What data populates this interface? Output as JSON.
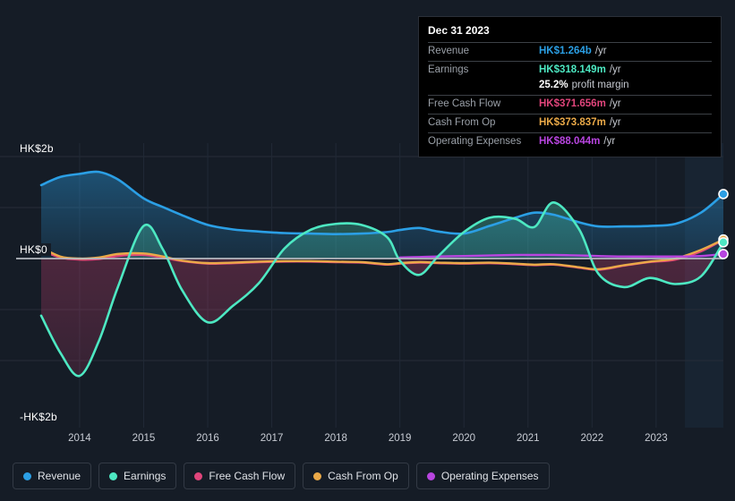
{
  "colors": {
    "background": "#151c26",
    "revenue": "#2b9fe5",
    "earnings": "#4de8c2",
    "free_cash_flow": "#e0457b",
    "cash_from_op": "#eaa948",
    "operating_expenses": "#b845e0",
    "zero_line": "#b9bdc4",
    "grid": "#262d38"
  },
  "tooltip": {
    "date": "Dec 31 2023",
    "rows": [
      {
        "key": "Revenue",
        "value": "HK$1.264b",
        "unit": "/yr",
        "color": "#2b9fe5"
      },
      {
        "key": "Earnings",
        "value": "HK$318.149m",
        "unit": "/yr",
        "color": "#4de8c2"
      },
      {
        "key": "",
        "value": "25.2%",
        "unit": "profit margin",
        "color": "#ffffff"
      },
      {
        "key": "Free Cash Flow",
        "value": "HK$371.656m",
        "unit": "/yr",
        "color": "#e0457b"
      },
      {
        "key": "Cash From Op",
        "value": "HK$373.837m",
        "unit": "/yr",
        "color": "#eaa948"
      },
      {
        "key": "Operating Expenses",
        "value": "HK$88.044m",
        "unit": "/yr",
        "color": "#b845e0"
      }
    ]
  },
  "legend": {
    "items": [
      {
        "label": "Revenue",
        "color": "#2b9fe5"
      },
      {
        "label": "Earnings",
        "color": "#4de8c2"
      },
      {
        "label": "Free Cash Flow",
        "color": "#e0457b"
      },
      {
        "label": "Cash From Op",
        "color": "#eaa948"
      },
      {
        "label": "Operating Expenses",
        "color": "#b845e0"
      }
    ]
  },
  "axis": {
    "y_top_label": "HK$2b",
    "y_zero_label": "HK$0",
    "y_bottom_label": "-HK$2b"
  },
  "chart_data": {
    "type": "area",
    "title": "",
    "xlabel": "",
    "ylabel": "HK$",
    "ylim": [
      -2.3,
      2.0
    ],
    "y_ticks": [
      2,
      1,
      0,
      -1,
      -2
    ],
    "y_tick_labels": [
      "HK$2b",
      "",
      "HK$0",
      "",
      "-HK$2b"
    ],
    "grid": true,
    "legend_position": "bottom",
    "x_tick_labels": [
      "2014",
      "2015",
      "2016",
      "2017",
      "2018",
      "2019",
      "2020",
      "2021",
      "2022",
      "2023"
    ],
    "x_tick_values": [
      2014,
      2015,
      2016,
      2017,
      2018,
      2019,
      2020,
      2021,
      2022,
      2023
    ],
    "forecast_band": {
      "start": 2023.45,
      "end": 2024.1
    },
    "x": [
      2013.4,
      2013.7,
      2014.0,
      2014.3,
      2014.6,
      2015.0,
      2015.3,
      2015.6,
      2016.0,
      2016.4,
      2016.8,
      2017.2,
      2017.6,
      2018.0,
      2018.4,
      2018.8,
      2019.0,
      2019.3,
      2019.6,
      2020.0,
      2020.4,
      2020.8,
      2021.1,
      2021.4,
      2021.8,
      2022.1,
      2022.5,
      2022.9,
      2023.3,
      2023.7,
      2024.05
    ],
    "series": [
      {
        "name": "Revenue",
        "color": "#2b9fe5",
        "fill": true,
        "values": [
          1.44,
          1.6,
          1.66,
          1.7,
          1.55,
          1.18,
          1.01,
          0.85,
          0.66,
          0.57,
          0.53,
          0.5,
          0.49,
          0.48,
          0.49,
          0.52,
          0.56,
          0.6,
          0.53,
          0.49,
          0.64,
          0.8,
          0.9,
          0.86,
          0.71,
          0.63,
          0.63,
          0.64,
          0.68,
          0.9,
          1.264
        ]
      },
      {
        "name": "Earnings",
        "color": "#4de8c2",
        "fill": true,
        "values": [
          -1.12,
          -1.85,
          -2.3,
          -1.62,
          -0.55,
          0.64,
          0.18,
          -0.62,
          -1.25,
          -0.92,
          -0.48,
          0.2,
          0.56,
          0.68,
          0.66,
          0.42,
          -0.04,
          -0.32,
          0.05,
          0.52,
          0.8,
          0.78,
          0.62,
          1.1,
          0.57,
          -0.3,
          -0.56,
          -0.38,
          -0.5,
          -0.35,
          0.318
        ]
      },
      {
        "name": "Free Cash Flow",
        "color": "#e0457b",
        "fill": false,
        "values": [
          0.17,
          0.02,
          -0.02,
          -0.01,
          0.05,
          0.07,
          0.02,
          -0.05,
          -0.1,
          -0.09,
          -0.07,
          -0.06,
          -0.06,
          -0.07,
          -0.08,
          -0.12,
          -0.1,
          -0.08,
          -0.09,
          -0.1,
          -0.09,
          -0.11,
          -0.13,
          -0.12,
          -0.18,
          -0.22,
          -0.14,
          -0.07,
          -0.02,
          0.14,
          0.372
        ]
      },
      {
        "name": "Cash From Op",
        "color": "#eaa948",
        "fill": false,
        "values": [
          0.22,
          0.04,
          0.0,
          0.02,
          0.09,
          0.1,
          0.04,
          -0.04,
          -0.09,
          -0.08,
          -0.06,
          -0.05,
          -0.05,
          -0.06,
          -0.07,
          -0.11,
          -0.09,
          -0.07,
          -0.08,
          -0.09,
          -0.08,
          -0.1,
          -0.12,
          -0.11,
          -0.17,
          -0.21,
          -0.13,
          -0.06,
          0.0,
          0.17,
          0.374
        ]
      },
      {
        "name": "Operating Expenses",
        "color": "#b845e0",
        "fill": false,
        "start_index": 16,
        "values": [
          null,
          null,
          null,
          null,
          null,
          null,
          null,
          null,
          null,
          null,
          null,
          null,
          null,
          null,
          null,
          null,
          0.02,
          0.03,
          0.04,
          0.05,
          0.06,
          0.07,
          0.07,
          0.07,
          0.06,
          0.05,
          0.04,
          0.04,
          0.04,
          0.05,
          0.088
        ]
      }
    ],
    "endpoints": [
      {
        "name": "Revenue",
        "color": "#2b9fe5"
      },
      {
        "name": "Cash From Op",
        "color": "#eaa948"
      },
      {
        "name": "Earnings",
        "color": "#4de8c2"
      },
      {
        "name": "Operating Expenses",
        "color": "#b845e0"
      }
    ]
  }
}
